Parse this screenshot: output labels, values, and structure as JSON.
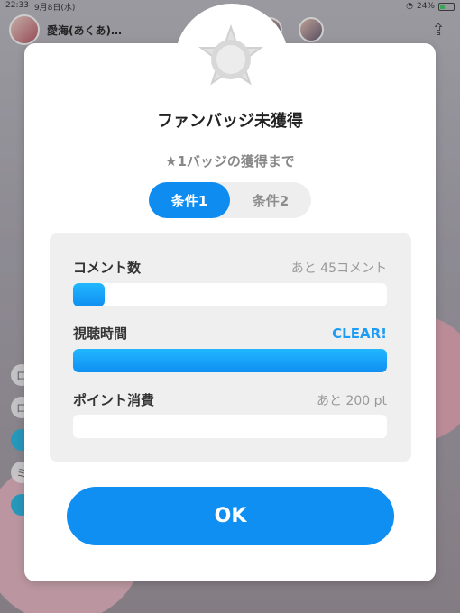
{
  "status_bar": {
    "time": "22:33",
    "date": "9月8日(水)",
    "battery": "24%"
  },
  "stream_header": {
    "streamer_name": "愛海(あくあ)…"
  },
  "left_tabs": [
    {
      "label": "ロ",
      "active": false
    },
    {
      "label": "ロ",
      "active": false
    },
    {
      "label": "",
      "active": true
    },
    {
      "label": "ミ",
      "active": false
    },
    {
      "label": "",
      "active": true
    }
  ],
  "dialog": {
    "title": "ファンバッジ未獲得",
    "subtitle": "★1バッジの獲得まで",
    "tabs": [
      {
        "label": "条件1",
        "active": true
      },
      {
        "label": "条件2",
        "active": false
      }
    ],
    "conditions": [
      {
        "label": "コメント数",
        "value": "あと 45コメント",
        "progress": 0.1
      },
      {
        "label": "視聴時間",
        "value": "CLEAR!",
        "progress": 1.0,
        "cleared": true
      },
      {
        "label": "ポイント消費",
        "value": "あと 200 pt",
        "progress": 0
      }
    ],
    "ok_label": "OK"
  },
  "colors": {
    "accent": "#0f8ff2",
    "clear_text": "#1c9cf3",
    "panel_bg": "#efefef"
  }
}
